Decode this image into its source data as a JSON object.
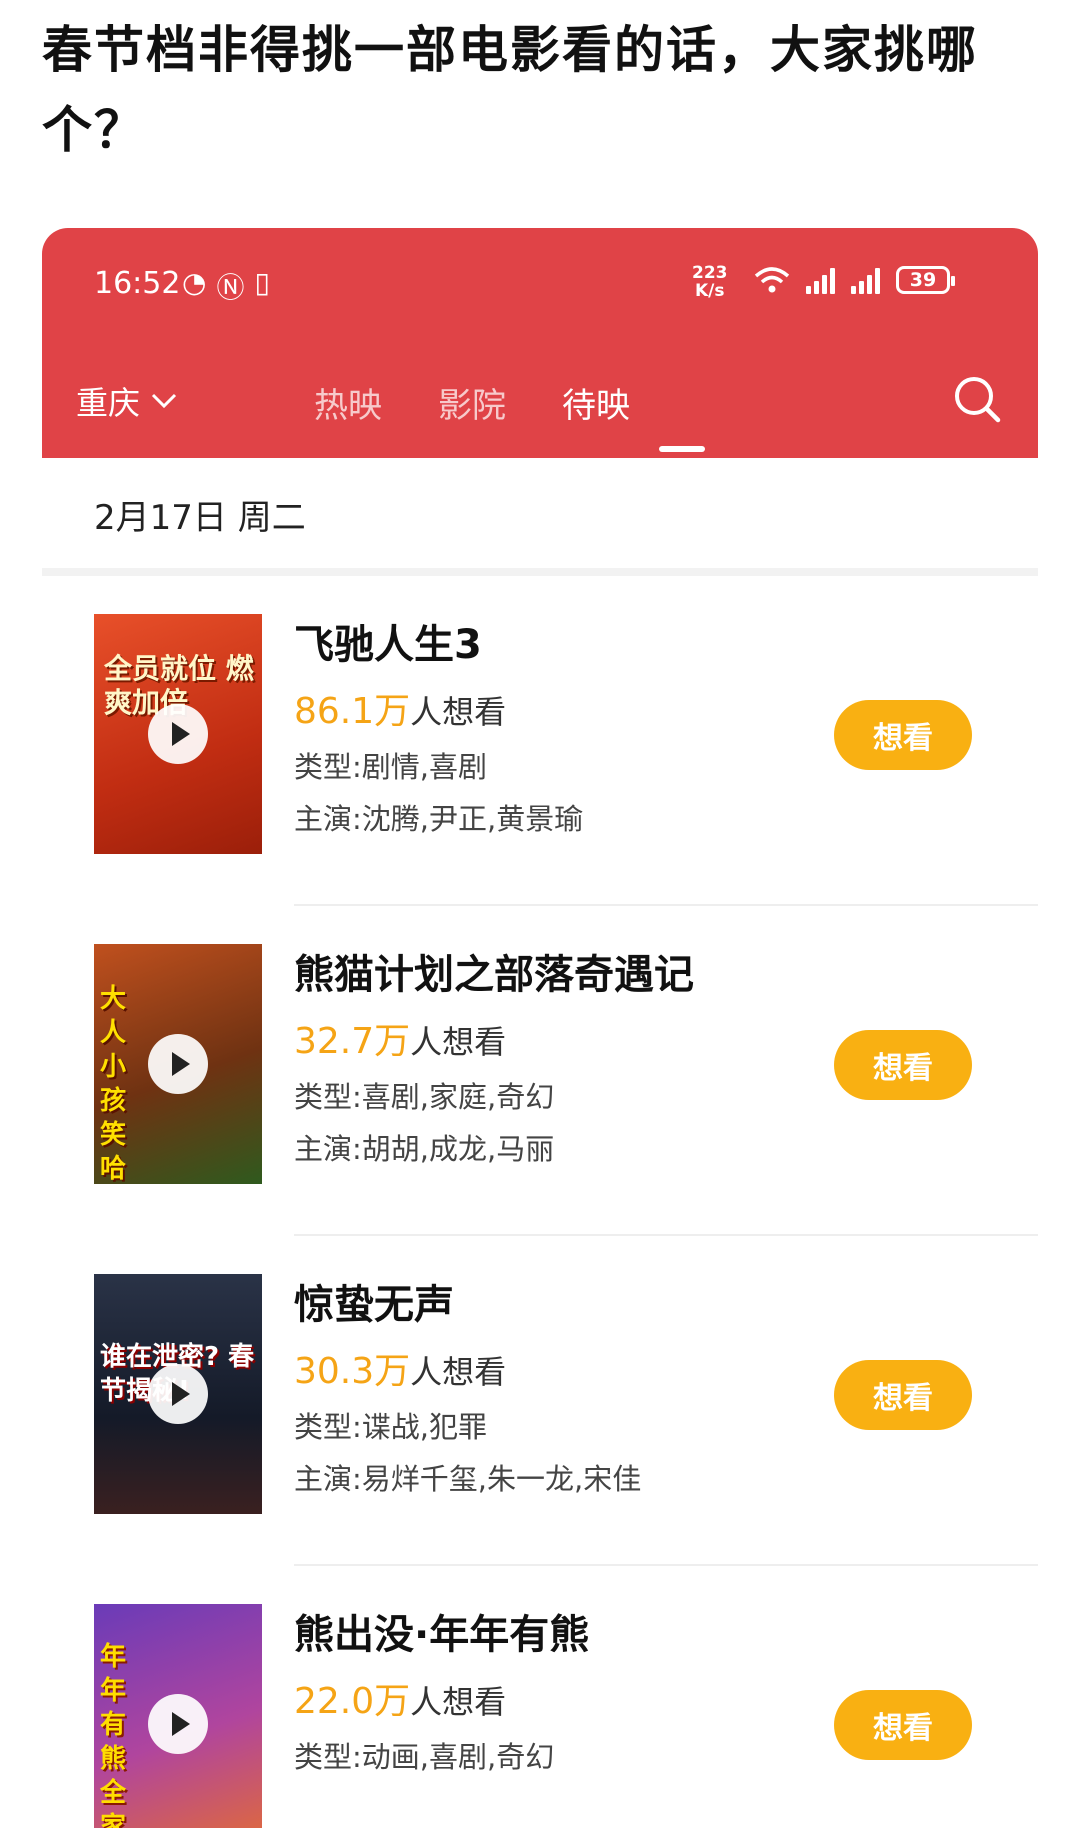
{
  "post": {
    "title": "春节档非得挑一部电影看的话，大家挑哪个？"
  },
  "status_bar": {
    "time": "16:52",
    "net_speed_value": "223",
    "net_speed_unit": "K/s",
    "battery": "39"
  },
  "nav": {
    "city": "重庆",
    "tabs": [
      "热映",
      "影院",
      "待映"
    ],
    "active_tab": "待映"
  },
  "date_label": "2月17日 周二",
  "want_suffix": "人想看",
  "want_button_label": "想看",
  "movies": [
    {
      "title": "飞驰人生3",
      "want_count": "86.1万",
      "genre": "类型:剧情,喜剧",
      "cast": "主演:沈腾,尹正,黄景瑜",
      "poster_text": "全员就位 燃爽加倍",
      "poster_color": "#d9431c"
    },
    {
      "title": "熊猫计划之部落奇遇记",
      "want_count": "32.7万",
      "genre": "类型:喜剧,家庭,奇幻",
      "cast": "主演:胡胡,成龙,马丽",
      "poster_text": "大人小孩 笑哈哈",
      "poster_color": "#8a3a14"
    },
    {
      "title": "惊蛰无声",
      "want_count": "30.3万",
      "genre": "类型:谍战,犯罪",
      "cast": "主演:易烊千玺,朱一龙,宋佳",
      "poster_text": "谁在泄密? 春节揭秘!",
      "poster_color": "#1b2233"
    },
    {
      "title": "熊出没·年年有熊",
      "want_count": "22.0万",
      "genre": "类型:动画,喜剧,奇幻",
      "cast": "",
      "poster_text": "年年有熊 全家爱看",
      "poster_color": "#9a3fb0"
    }
  ],
  "colors": {
    "header_red": "#e04347",
    "want_yellow": "#f9b012",
    "count_orange": "#f5a416"
  }
}
